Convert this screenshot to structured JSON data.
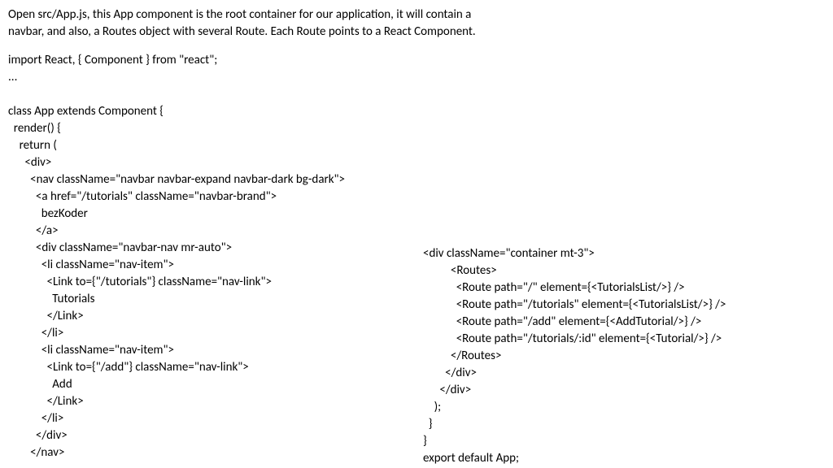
{
  "intro": {
    "line1": "Open src/App.js, this App component is the root container for our application, it will contain a",
    "line2": "navbar, and also, a Routes object with several Route. Each Route points to a React Component."
  },
  "codeLeft": [
    "import React, { Component } from \"react\";",
    "...",
    "",
    "class App extends Component {",
    "  render() {",
    "    return (",
    "      <div>",
    "        <nav className=\"navbar navbar-expand navbar-dark bg-dark\">",
    "          <a href=\"/tutorials\" className=\"navbar-brand\">",
    "            bezKoder",
    "          </a>",
    "          <div className=\"navbar-nav mr-auto\">",
    "            <li className=\"nav-item\">",
    "              <Link to={\"/tutorials\"} className=\"nav-link\">",
    "                Tutorials",
    "              </Link>",
    "            </li>",
    "            <li className=\"nav-item\">",
    "              <Link to={\"/add\"} className=\"nav-link\">",
    "                Add",
    "              </Link>",
    "            </li>",
    "          </div>",
    "        </nav>"
  ],
  "codeRight": [
    "<div className=\"container mt-3\">",
    "          <Routes>",
    "            <Route path=\"/\" element={<TutorialsList/>} />",
    "            <Route path=\"/tutorials\" element={<TutorialsList/>} />",
    "            <Route path=\"/add\" element={<AddTutorial/>} />",
    "            <Route path=\"/tutorials/:id\" element={<Tutorial/>} />",
    "          </Routes>",
    "        </div>",
    "      </div>",
    "    );",
    "  }",
    "}",
    "export default App;"
  ]
}
